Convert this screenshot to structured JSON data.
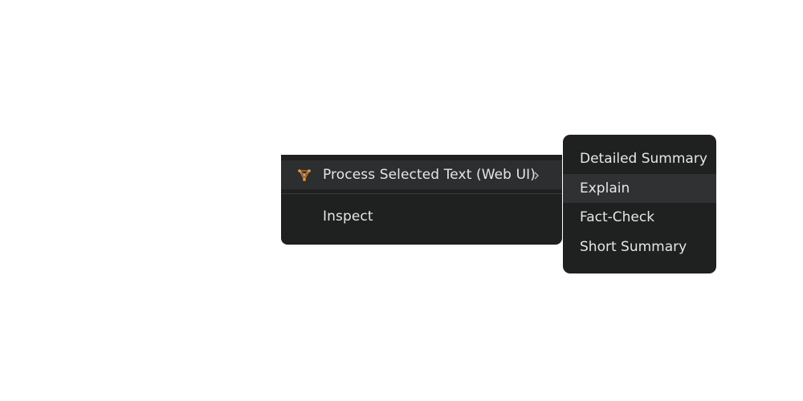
{
  "context_menu": {
    "items": [
      {
        "label": "Process Selected Text (Web UI)",
        "icon": "spark-network-icon",
        "has_submenu": true
      },
      {
        "label": "Inspect"
      }
    ],
    "chevron": "›"
  },
  "submenu": {
    "items": [
      {
        "label": "Detailed Summary"
      },
      {
        "label": "Explain"
      },
      {
        "label": "Fact-Check"
      },
      {
        "label": "Short Summary"
      }
    ]
  },
  "colors": {
    "menu_bg": "#1f2020",
    "highlight_bg": "#2d2e2f",
    "text": "#e6e6e6",
    "icon_accent": "#d9822b"
  }
}
